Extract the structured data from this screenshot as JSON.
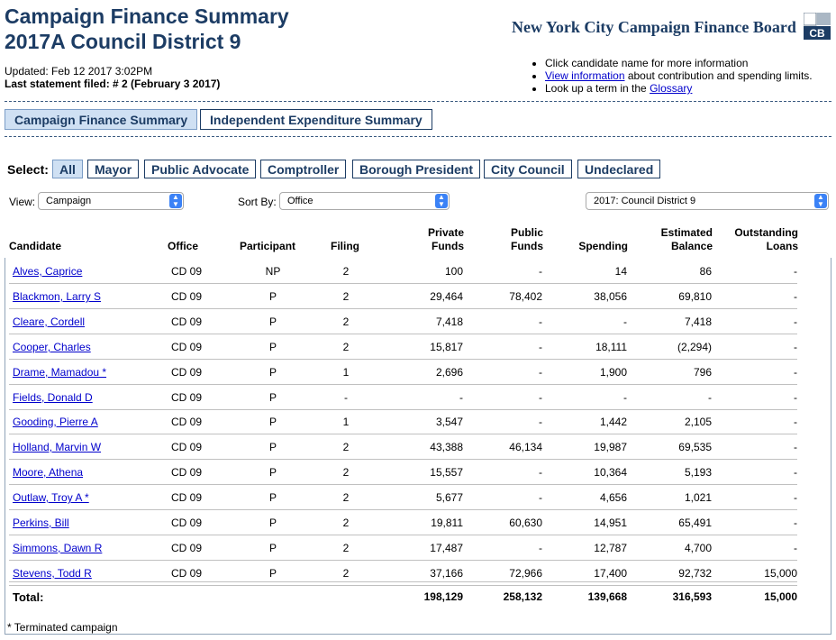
{
  "header": {
    "title_line1": "Campaign Finance Summary",
    "title_line2": "2017A Council District 9",
    "updated": "Updated: Feb 12 2017 3:02PM",
    "last_statement": "Last statement filed: # 2 (February 3 2017)",
    "board_name": "New York City Campaign Finance Board",
    "logo_text": "CB"
  },
  "info": {
    "item1": "Click candidate name for more information",
    "item2_link": "View information",
    "item2_rest": " about contribution and spending limits.",
    "item3_prefix": "Look up a term in the ",
    "item3_link": "Glossary"
  },
  "tabs": [
    {
      "label": "Campaign Finance Summary",
      "active": true
    },
    {
      "label": "Independent Expenditure Summary",
      "active": false
    }
  ],
  "select": {
    "label": "Select:",
    "options": [
      "All",
      "Mayor",
      "Public Advocate",
      "Comptroller",
      "Borough President",
      "City Council",
      "Undeclared"
    ],
    "active": "All"
  },
  "controls": {
    "view_label": "View:",
    "view_value": "Campaign",
    "sort_label": "Sort By:",
    "sort_value": "Office",
    "election_value": "2017: Council District 9"
  },
  "table": {
    "headers": {
      "candidate": "Candidate",
      "office": "Office",
      "participant": "Participant",
      "filing": "Filing",
      "private1": "Private",
      "private2": "Funds",
      "public1": "Public",
      "public2": "Funds",
      "spending": "Spending",
      "estimated1": "Estimated",
      "estimated2": "Balance",
      "outstanding1": "Outstanding",
      "outstanding2": "Loans"
    },
    "rows": [
      [
        "Alves, Caprice",
        "CD 09",
        "NP",
        "2",
        "100",
        "-",
        "14",
        "86",
        "-"
      ],
      [
        "Blackmon, Larry S",
        "CD 09",
        "P",
        "2",
        "29,464",
        "78,402",
        "38,056",
        "69,810",
        "-"
      ],
      [
        "Cleare, Cordell",
        "CD 09",
        "P",
        "2",
        "7,418",
        "-",
        "-",
        "7,418",
        "-"
      ],
      [
        "Cooper, Charles",
        "CD 09",
        "P",
        "2",
        "15,817",
        "-",
        "18,111",
        "(2,294)",
        "-"
      ],
      [
        "Drame, Mamadou *",
        "CD 09",
        "P",
        "1",
        "2,696",
        "-",
        "1,900",
        "796",
        "-"
      ],
      [
        "Fields, Donald D",
        "CD 09",
        "P",
        "-",
        "-",
        "-",
        "-",
        "-",
        "-"
      ],
      [
        "Gooding, Pierre A",
        "CD 09",
        "P",
        "1",
        "3,547",
        "-",
        "1,442",
        "2,105",
        "-"
      ],
      [
        "Holland, Marvin W",
        "CD 09",
        "P",
        "2",
        "43,388",
        "46,134",
        "19,987",
        "69,535",
        "-"
      ],
      [
        "Moore, Athena",
        "CD 09",
        "P",
        "2",
        "15,557",
        "-",
        "10,364",
        "5,193",
        "-"
      ],
      [
        "Outlaw, Troy A *",
        "CD 09",
        "P",
        "2",
        "5,677",
        "-",
        "4,656",
        "1,021",
        "-"
      ],
      [
        "Perkins, Bill",
        "CD 09",
        "P",
        "2",
        "19,811",
        "60,630",
        "14,951",
        "65,491",
        "-"
      ],
      [
        "Simmons, Dawn R",
        "CD 09",
        "P",
        "2",
        "17,487",
        "-",
        "12,787",
        "4,700",
        "-"
      ],
      [
        "Stevens, Todd R",
        "CD 09",
        "P",
        "2",
        "37,166",
        "72,966",
        "17,400",
        "92,732",
        "15,000"
      ]
    ],
    "total": {
      "label": "Total:",
      "private": "198,129",
      "public": "258,132",
      "spending": "139,668",
      "estimated": "316,593",
      "outstanding": "15,000"
    }
  },
  "footnote": "* Terminated campaign"
}
